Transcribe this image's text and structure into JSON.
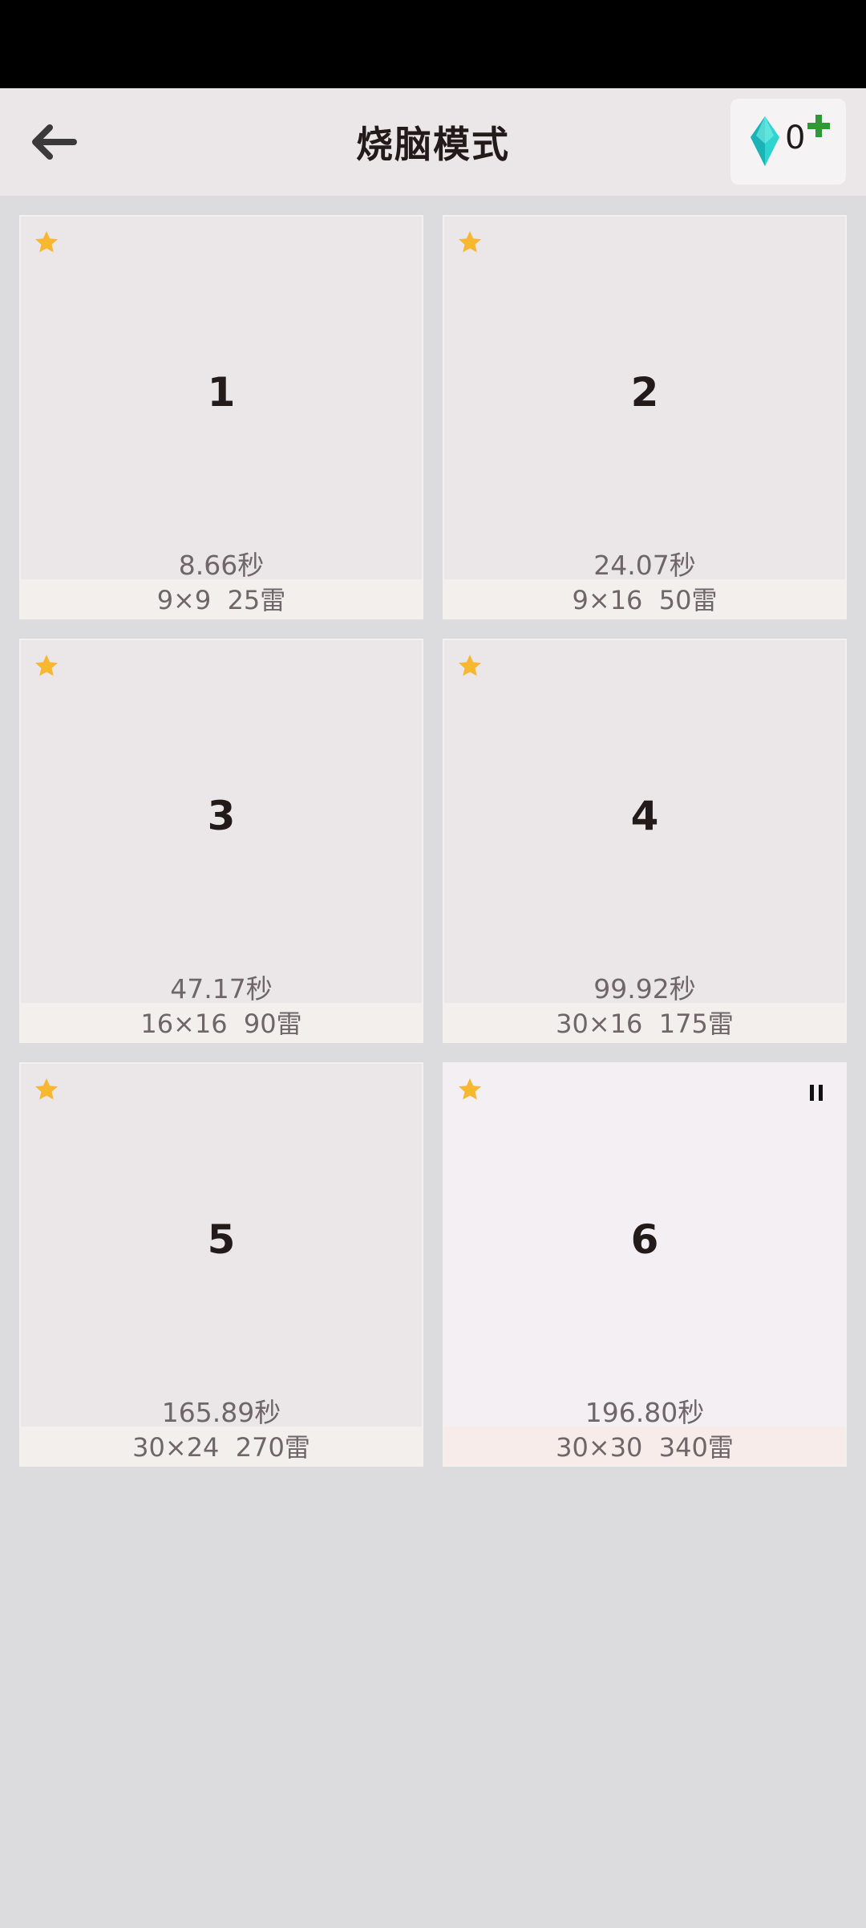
{
  "header": {
    "title": "烧脑模式",
    "gem_count": "0"
  },
  "colors": {
    "star": "#f7b731",
    "gem": "#2fd4d0",
    "plus": "#2e9a35",
    "title": "#231a1a"
  },
  "icons": {
    "back": "arrow-left-icon",
    "gem": "diamond-icon",
    "add": "plus-icon",
    "star": "star-icon",
    "pause": "pause-icon"
  },
  "levels": [
    {
      "level": "1",
      "time": "8.66秒",
      "info": "9×9  25雷",
      "paused": false
    },
    {
      "level": "2",
      "time": "24.07秒",
      "info": "9×16  50雷",
      "paused": false
    },
    {
      "level": "3",
      "time": "47.17秒",
      "info": "16×16  90雷",
      "paused": false
    },
    {
      "level": "4",
      "time": "99.92秒",
      "info": "30×16  175雷",
      "paused": false
    },
    {
      "level": "5",
      "time": "165.89秒",
      "info": "30×24  270雷",
      "paused": false
    },
    {
      "level": "6",
      "time": "196.80秒",
      "info": "30×30  340雷",
      "paused": true
    }
  ]
}
